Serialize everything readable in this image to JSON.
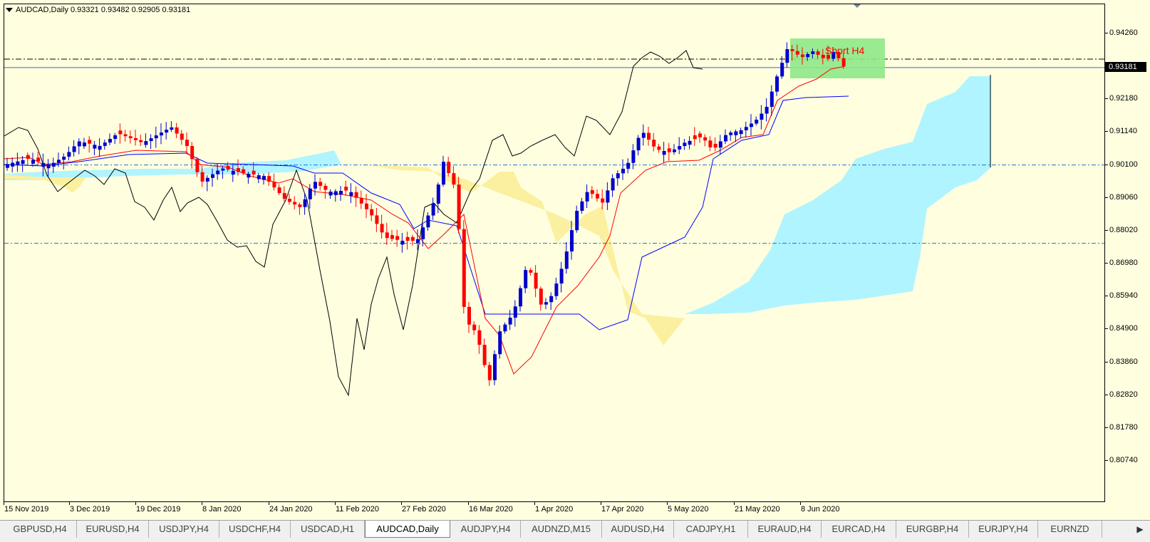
{
  "chart": {
    "symbol_line": "AUDCAD,Daily  0.93321 0.93482 0.92905 0.93181",
    "current_price": "0.93181",
    "annotation": "Short H4",
    "colors": {
      "background": "#ffffe0",
      "bull_candle": "#0000cc",
      "bear_candle": "#ff0000",
      "tenkan": "#ff0000",
      "kijun": "#0000ff",
      "chikou": "#000000",
      "kumo_bull": "#b0f4ff",
      "kumo_bear": "#fbf0a0",
      "zone": "#8fe888",
      "hline": "#1f6fd8"
    }
  },
  "price_axis": {
    "labels": [
      "0.94260",
      "0.93181",
      "0.92180",
      "0.91140",
      "0.90100",
      "0.89060",
      "0.88020",
      "0.86980",
      "0.85940",
      "0.84900",
      "0.83860",
      "0.82820",
      "0.81780",
      "0.80740"
    ]
  },
  "time_axis": {
    "labels": [
      "15 Nov 2019",
      "3 Dec 2019",
      "19 Dec 2019",
      "8 Jan 2020",
      "24 Jan 2020",
      "11 Feb 2020",
      "27 Feb 2020",
      "16 Mar 2020",
      "1 Apr 2020",
      "17 Apr 2020",
      "5 May 2020",
      "21 May 2020",
      "8 Jun 2020"
    ]
  },
  "tabs": [
    {
      "label": "GBPUSD,H4"
    },
    {
      "label": "EURUSD,H4"
    },
    {
      "label": "USDJPY,H4"
    },
    {
      "label": "USDCHF,H4"
    },
    {
      "label": "USDCAD,H1"
    },
    {
      "label": "AUDCAD,Daily",
      "active": true
    },
    {
      "label": "AUDJPY,H4"
    },
    {
      "label": "AUDNZD,M15"
    },
    {
      "label": "AUDUSD,H4"
    },
    {
      "label": "CADJPY,H1"
    },
    {
      "label": "EURAUD,H4"
    },
    {
      "label": "EURCAD,H4"
    },
    {
      "label": "EURGBP,H4"
    },
    {
      "label": "EURJPY,H4"
    },
    {
      "label": "EURNZD"
    }
  ],
  "tab_scroll_icon": "chevron-right-icon"
}
